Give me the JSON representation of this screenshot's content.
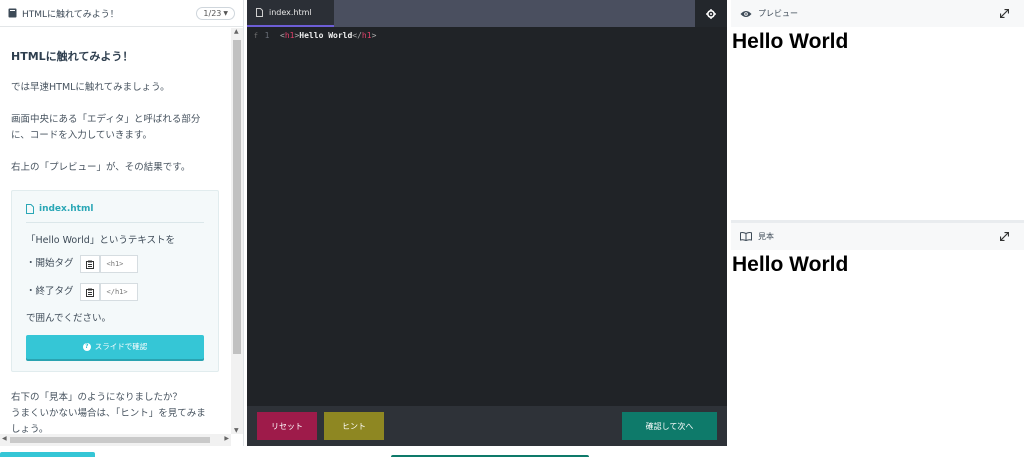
{
  "lesson": {
    "header_title": "HTMLに触れてみよう！",
    "pager": "1/23",
    "heading": "HTMLに触れてみよう！",
    "para1": "では早速HTMLに触れてみましょう。",
    "para2_line1": "画面中央にある「エディタ」と呼ばれる部分",
    "para2_line2": "に、コードを入力していきます。",
    "para3": "右上の「プレビュー」が、その結果です。",
    "card": {
      "file": "index.html",
      "instruction": "「Hello World」というテキストを",
      "open_label": "・開始タグ",
      "open_tag": "<h1>",
      "close_label": "・終了タグ",
      "close_tag": "</h1>",
      "wrap_text": "で囲んでください。",
      "slide_button": "スライドで確認"
    },
    "para4": "右下の「見本」のようになりましたか？",
    "para5_line1": "うまくいかない場合は、「ヒント」を見てみま",
    "para5_line2": "しょう。"
  },
  "editor": {
    "tab": "index.html",
    "gutter_mark": "f",
    "line_number": "1",
    "code": {
      "lt1": "<",
      "tag1": "h1",
      "gt1": ">",
      "text": "Hello World",
      "lt2": "</",
      "tag2": "h1",
      "gt2": ">"
    },
    "reset": "リセット",
    "hint": "ヒント",
    "next": "確認して次へ"
  },
  "preview": {
    "label": "プレビュー",
    "heading": "Hello World"
  },
  "sample": {
    "label": "見本",
    "heading": "Hello World"
  },
  "colors": {
    "accent_cyan": "#35c6d6",
    "reset_red": "#9e1b4a",
    "hint_olive": "#8e8722",
    "next_green": "#0e7a6a",
    "tab_underline": "#6d5ed6"
  }
}
